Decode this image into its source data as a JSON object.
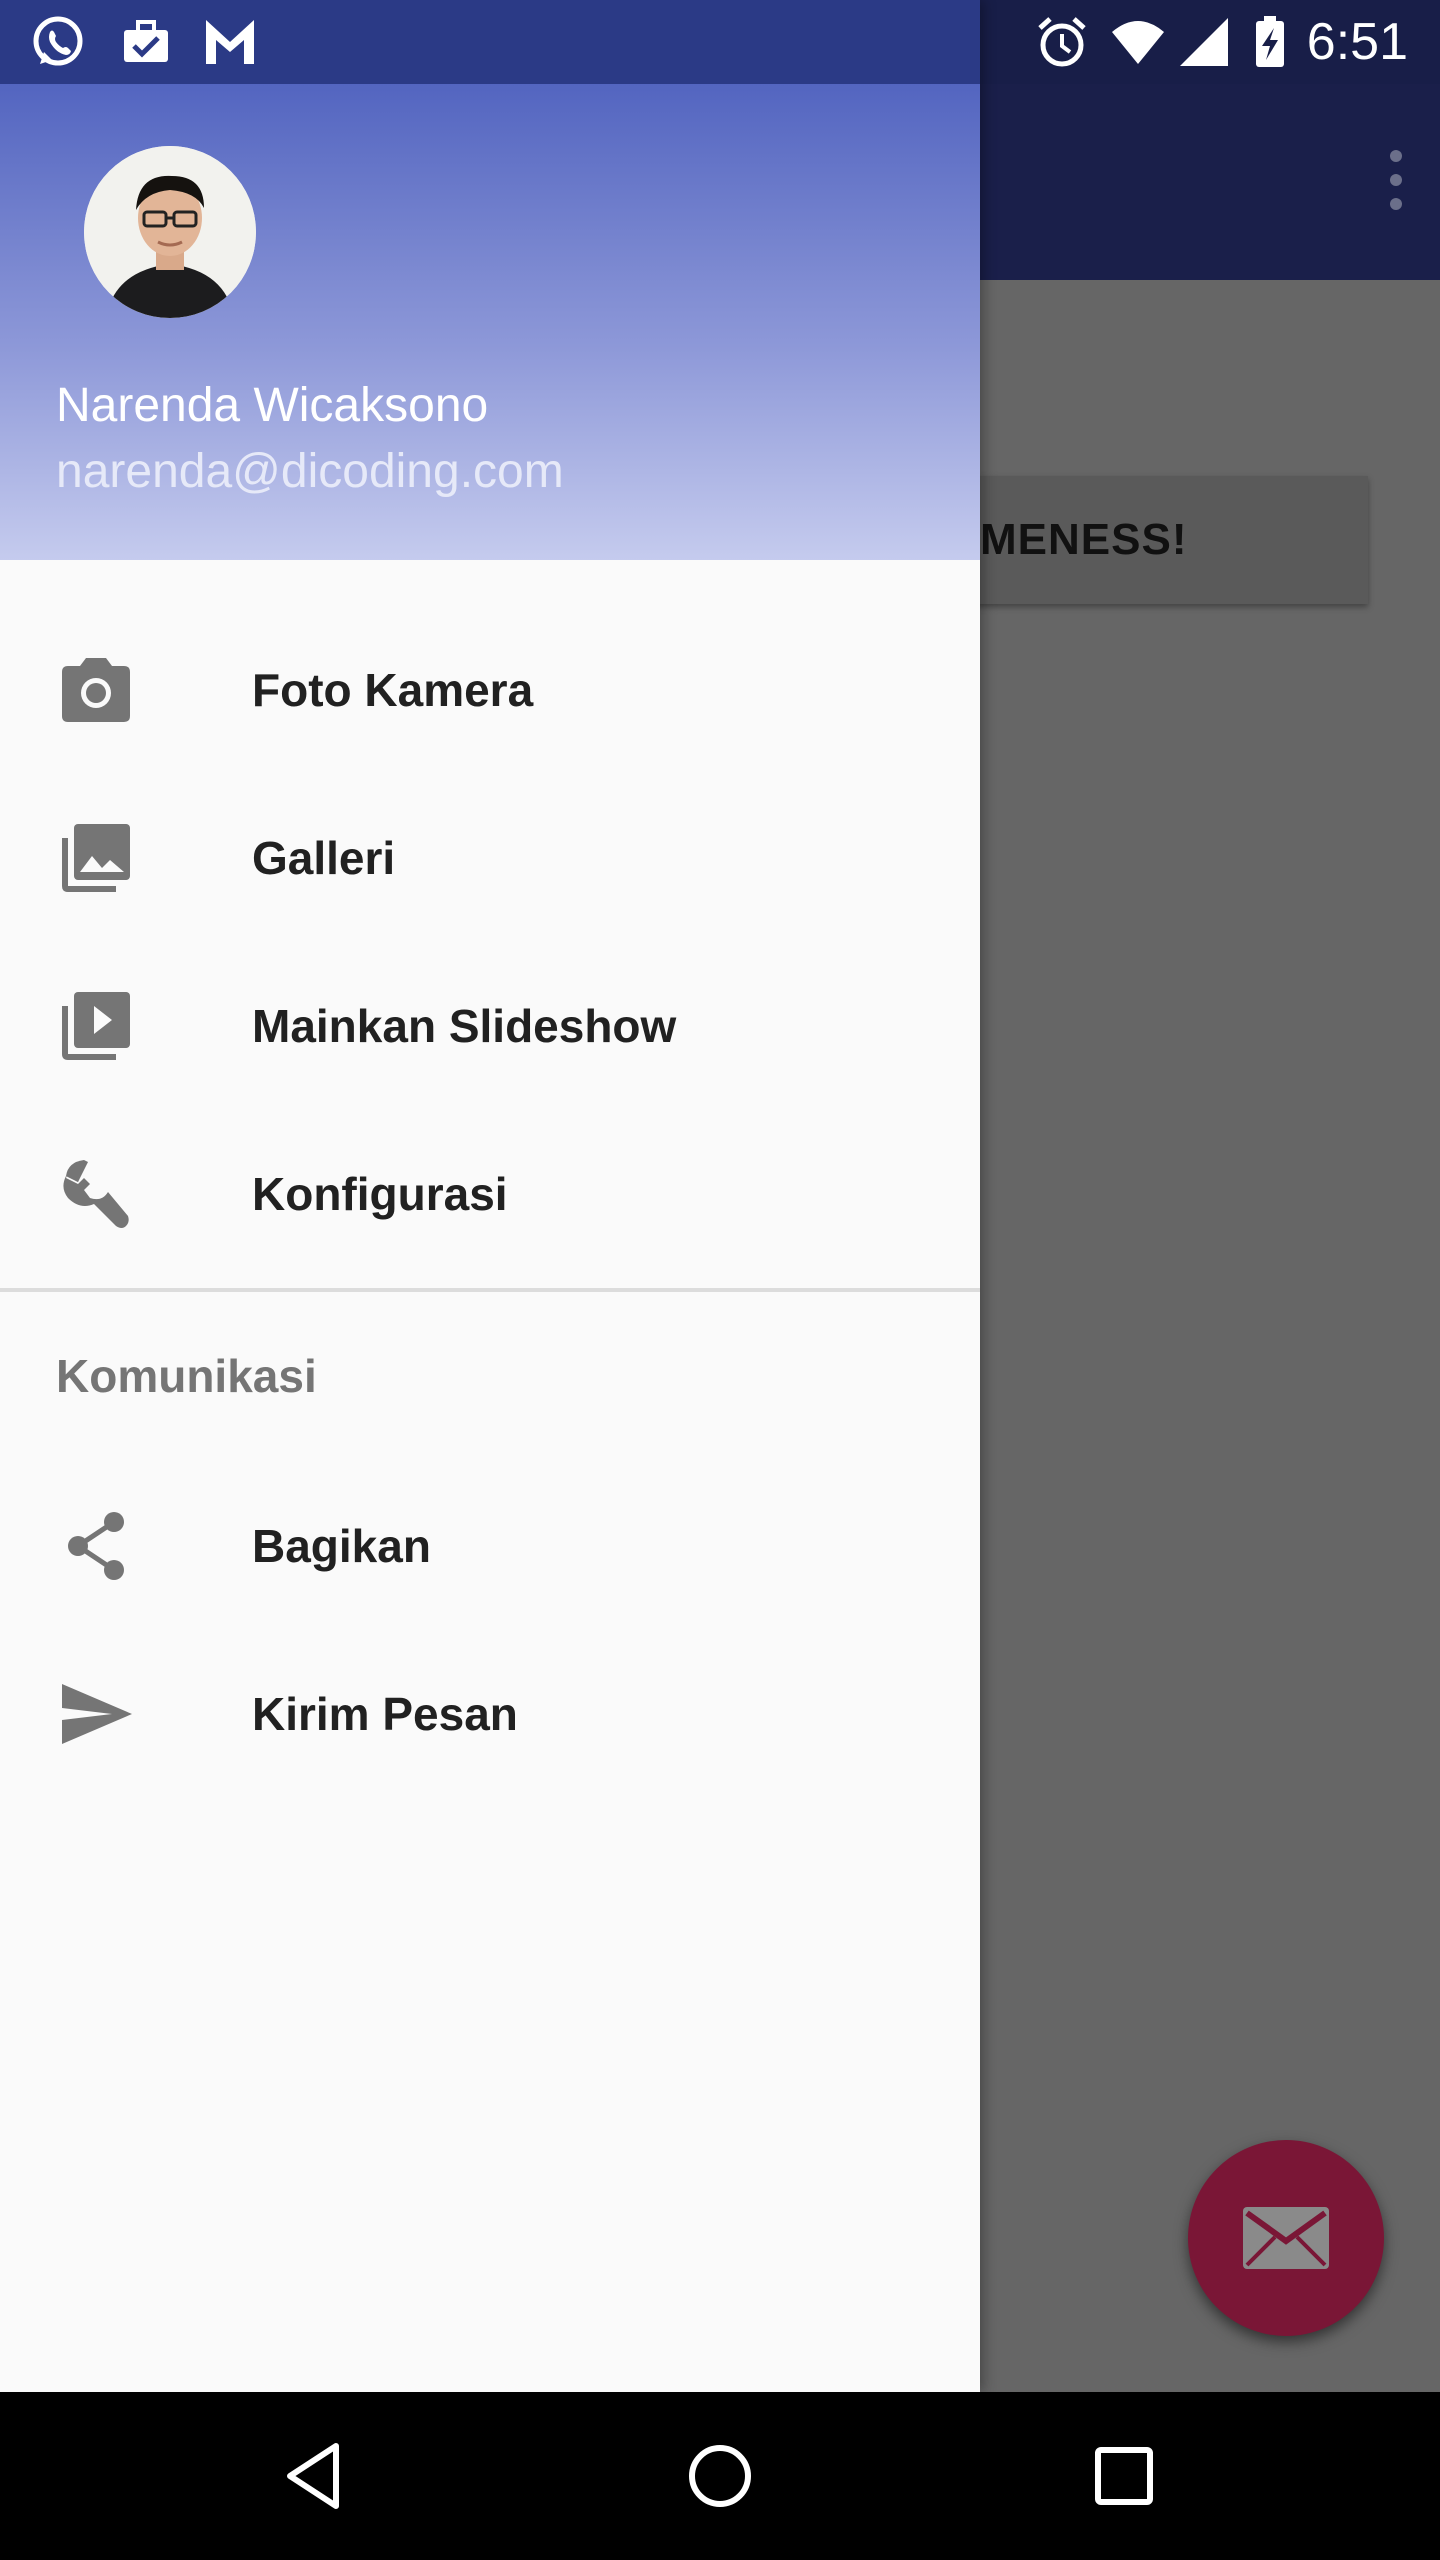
{
  "status_bar": {
    "time": "6:51",
    "left_icons": [
      "whatsapp-icon",
      "briefcase-check-icon",
      "gmail-icon"
    ],
    "right_icons": [
      "alarm-icon",
      "wifi-icon",
      "signal-icon",
      "battery-charging-icon"
    ]
  },
  "drawer": {
    "header": {
      "name": "Narenda Wicaksono",
      "email": "narenda@dicoding.com"
    },
    "items": [
      {
        "label": "Foto Kamera",
        "icon": "camera-icon"
      },
      {
        "label": "Galleri",
        "icon": "gallery-icon"
      },
      {
        "label": "Mainkan Slideshow",
        "icon": "slideshow-icon"
      },
      {
        "label": "Konfigurasi",
        "icon": "wrench-icon"
      }
    ],
    "section": {
      "title": "Komunikasi",
      "items": [
        {
          "label": "Bagikan",
          "icon": "share-icon"
        },
        {
          "label": "Kirim Pesan",
          "icon": "send-icon"
        }
      ]
    }
  },
  "background_app": {
    "button_partial_label": "MENESS!",
    "fab_icon": "mail-icon",
    "overflow_icon": "more-vert-icon"
  },
  "nav_bar": {
    "buttons": [
      "back-icon",
      "home-icon",
      "recents-icon"
    ]
  },
  "colors": {
    "primary": "#3F51B5",
    "accent": "#7a1636",
    "drawer_bg": "#fafafa"
  }
}
